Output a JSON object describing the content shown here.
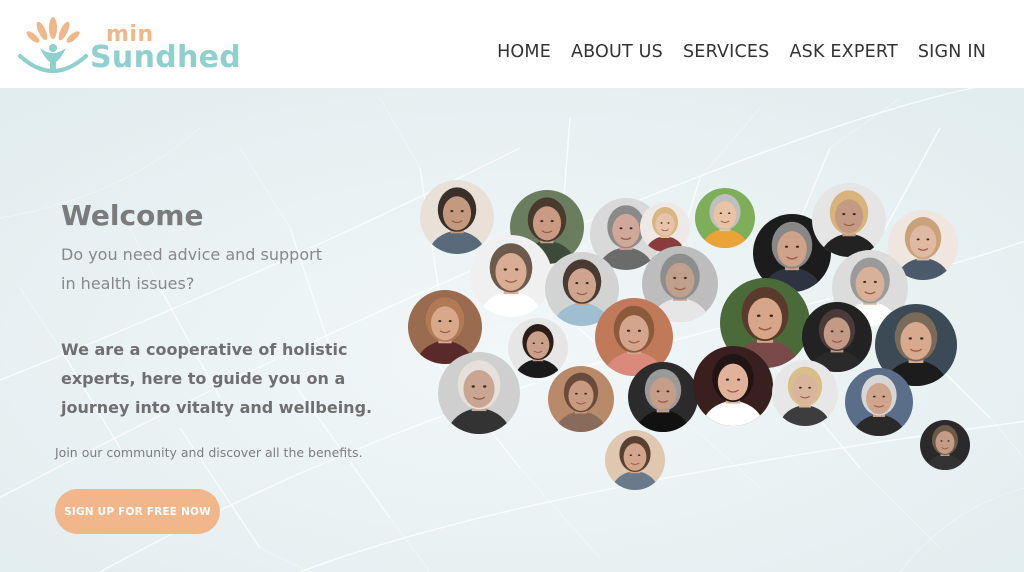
{
  "brand": {
    "min": "min",
    "name": "Sundhed",
    "icon": "lotus-person-logo-icon",
    "colors": {
      "orange": "#f0b789",
      "teal": "#8fcfcc"
    }
  },
  "nav": {
    "items": [
      {
        "label": "HOME"
      },
      {
        "label": "ABOUT US"
      },
      {
        "label": "SERVICES"
      },
      {
        "label": "ASK EXPERT"
      },
      {
        "label": "SIGN IN"
      }
    ]
  },
  "hero": {
    "title": "Welcome",
    "question_line1": "Do you need advice and support",
    "question_line2": "in health issues?",
    "intro_line1": "We are a cooperative of holistic",
    "intro_line2": "experts, here to guide you on a",
    "intro_line3": "journey into vitalty and wellbeing.",
    "join_text": "Join our community and discover all the benefits.",
    "cta_label": "SIGN UP FOR FREE NOW",
    "cta_color": "#f2b68b"
  },
  "collage": {
    "experts": [
      {
        "name": "expert-portrait"
      },
      {
        "name": "expert-portrait"
      },
      {
        "name": "expert-portrait"
      },
      {
        "name": "expert-portrait"
      },
      {
        "name": "expert-portrait"
      },
      {
        "name": "expert-portrait"
      },
      {
        "name": "expert-portrait"
      },
      {
        "name": "expert-portrait"
      },
      {
        "name": "expert-portrait"
      },
      {
        "name": "expert-portrait"
      },
      {
        "name": "expert-portrait"
      },
      {
        "name": "expert-portrait"
      },
      {
        "name": "expert-portrait"
      },
      {
        "name": "expert-portrait"
      },
      {
        "name": "expert-portrait"
      },
      {
        "name": "expert-portrait"
      },
      {
        "name": "expert-portrait"
      },
      {
        "name": "expert-portrait"
      },
      {
        "name": "expert-portrait"
      },
      {
        "name": "expert-portrait"
      },
      {
        "name": "expert-portrait"
      },
      {
        "name": "expert-portrait"
      },
      {
        "name": "expert-portrait"
      },
      {
        "name": "expert-portrait"
      },
      {
        "name": "expert-portrait"
      },
      {
        "name": "expert-portrait"
      }
    ]
  }
}
